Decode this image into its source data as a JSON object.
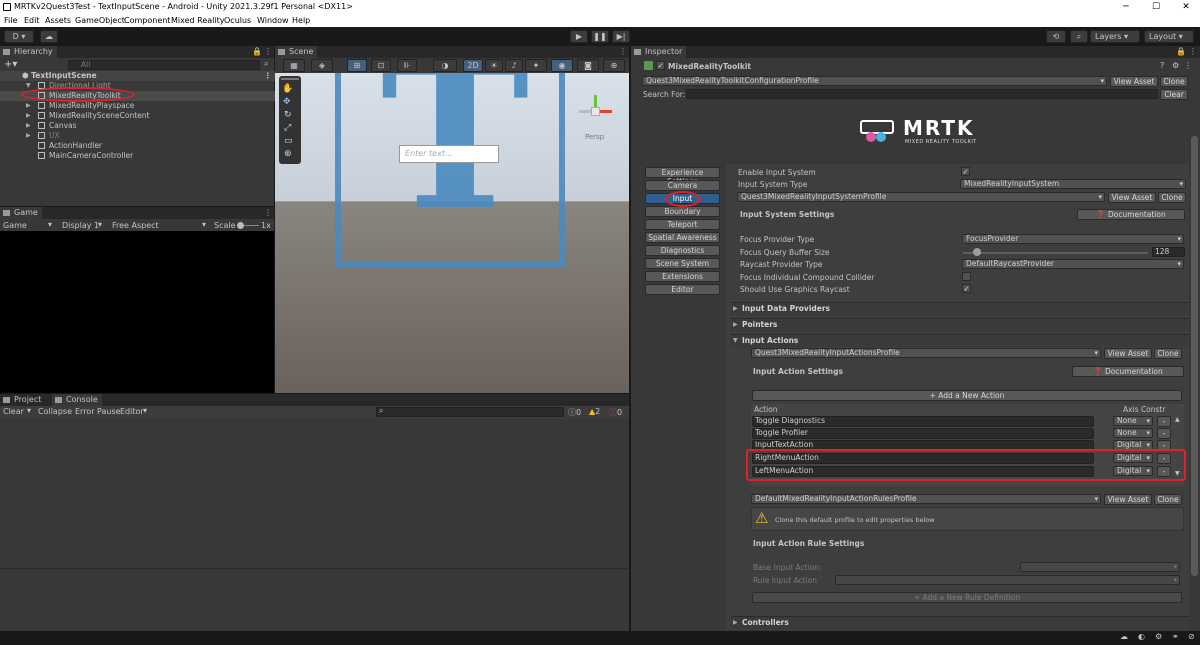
{
  "window": {
    "title": "MRTKv2Quest3Test - TextInputScene - Android - Unity 2021.3.29f1 Personal <DX11>",
    "minimize": "─",
    "maximize": "☐",
    "close": "✕"
  },
  "menu": [
    "File",
    "Edit",
    "Assets",
    "GameObject",
    "Component",
    "Mixed Reality",
    "Oculus",
    "Window",
    "Help"
  ],
  "toolbar": {
    "account": "D ▾",
    "layers": "Layers",
    "layout": "Layout"
  },
  "hierarchy": {
    "tab": "Hierarchy",
    "search_placeholder": "All",
    "scene": "TextInputScene",
    "items": [
      "Directional Light",
      "MixedRealityToolkit",
      "MixedRealityPlayspace",
      "MixedRealitySceneContent",
      "Canvas",
      "UX",
      "ActionHandler",
      "MainCameraController"
    ]
  },
  "scene": {
    "tab": "Scene",
    "mode2d": "2D",
    "placeholder": "Enter text...",
    "persp": "Persp",
    "letter": "T"
  },
  "game": {
    "tab": "Game",
    "display_mode": "Game",
    "display": "Display 1",
    "aspect": "Free Aspect",
    "scale_label": "Scale",
    "scale_value": "1x"
  },
  "console": {
    "project_tab": "Project",
    "console_tab": "Console",
    "clear": "Clear",
    "collapse": "Collapse",
    "error_pause": "Error Pause",
    "editor": "Editor",
    "count_info": "0",
    "count_warn": "2",
    "count_error": "0"
  },
  "inspector": {
    "tab": "Inspector",
    "component": "MixedRealityToolkit",
    "profile": "Quest3MixedRealityToolkitConfigurationProfile",
    "view_asset": "View Asset",
    "clone": "Clone",
    "search_for": "Search For:",
    "clear": "Clear",
    "logo_title": "MRTK",
    "logo_sub": "MIXED REALITY TOOLKIT",
    "nav": [
      "Experience Settings",
      "Camera",
      "Input",
      "Boundary",
      "Teleport",
      "Spatial Awareness",
      "Diagnostics",
      "Scene System",
      "Extensions",
      "Editor"
    ],
    "enable_input": "Enable Input System",
    "input_system_type": "Input System Type",
    "input_system_value": "MixedRealityInputSystem",
    "input_profile": "Quest3MixedRealityInputSystemProfile",
    "input_system_settings": "Input System Settings",
    "documentation": "Documentation",
    "focus_provider_type": "Focus Provider Type",
    "focus_provider_value": "FocusProvider",
    "focus_query": "Focus Query Buffer Size",
    "focus_query_value": "128",
    "raycast_type": "Raycast Provider Type",
    "raycast_value": "DefaultRaycastProvider",
    "focus_compound": "Focus Individual Compound Collider",
    "graphics_raycast": "Should Use Graphics Raycast",
    "input_data_providers": "Input Data Providers",
    "pointers": "Pointers",
    "input_actions": "Input Actions",
    "actions_profile": "Quest3MixedRealityInputActionsProfile",
    "input_action_settings": "Input Action Settings",
    "add_action": "+ Add a New Action",
    "col_action": "Action",
    "col_axis": "Axis Constr",
    "actions": [
      {
        "name": "Toggle Diagnostics",
        "axis": "None"
      },
      {
        "name": "Toggle Profiler",
        "axis": "None"
      },
      {
        "name": "InputTextAction",
        "axis": "Digital"
      },
      {
        "name": "RightMenuAction",
        "axis": "Digital"
      },
      {
        "name": "LeftMenuAction",
        "axis": "Digital"
      }
    ],
    "remove": "-",
    "rules_profile": "DefaultMixedRealityInputActionRulesProfile",
    "clone_warning": "Clone this default profile to edit properties below",
    "rule_settings": "Input Action Rule Settings",
    "base_input_action": "Base Input Action:",
    "rule_input_action": "Rule Input Action",
    "add_rule": "+ Add a New Rule Definition",
    "controllers": "Controllers"
  }
}
